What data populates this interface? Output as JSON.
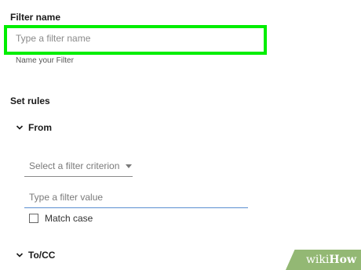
{
  "filter_name": {
    "heading": "Filter name",
    "placeholder": "Type a filter name",
    "value": "",
    "hint": "Name your Filter",
    "highlight_color": "#00ee00"
  },
  "rules": {
    "heading": "Set rules",
    "from_section": {
      "label": "From",
      "expand_icon": "chevron-down-icon",
      "criterion_select": {
        "selected": "Select a filter criterion",
        "icon": "caret-down-icon"
      },
      "value_input": {
        "placeholder": "Type a filter value",
        "value": ""
      },
      "match_case": {
        "label": "Match case",
        "checked": false
      }
    },
    "tocc_section": {
      "label": "To/CC",
      "expand_icon": "chevron-down-icon"
    }
  },
  "watermark": {
    "part1": "wiki",
    "part2": "How",
    "color": "#93b874"
  }
}
